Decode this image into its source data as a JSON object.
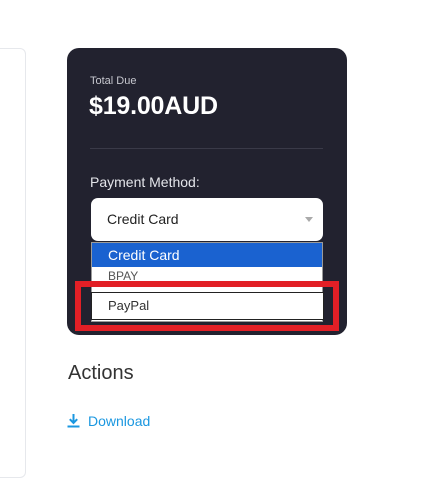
{
  "summary": {
    "total_label": "Total Due",
    "total_amount": "$19.00AUD",
    "payment_method_label": "Payment Method:",
    "selected_method": "Credit Card"
  },
  "dropdown": {
    "options": [
      "Credit Card",
      "BPAY",
      "PayPal"
    ]
  },
  "actions": {
    "heading": "Actions",
    "download_label": "Download"
  },
  "colors": {
    "card_background": "#22222f",
    "selected_option": "#1a62d0",
    "highlight": "#e21f26",
    "link": "#1a97e0"
  },
  "icons": {
    "download": "download-icon",
    "caret": "chevron-down-icon"
  }
}
